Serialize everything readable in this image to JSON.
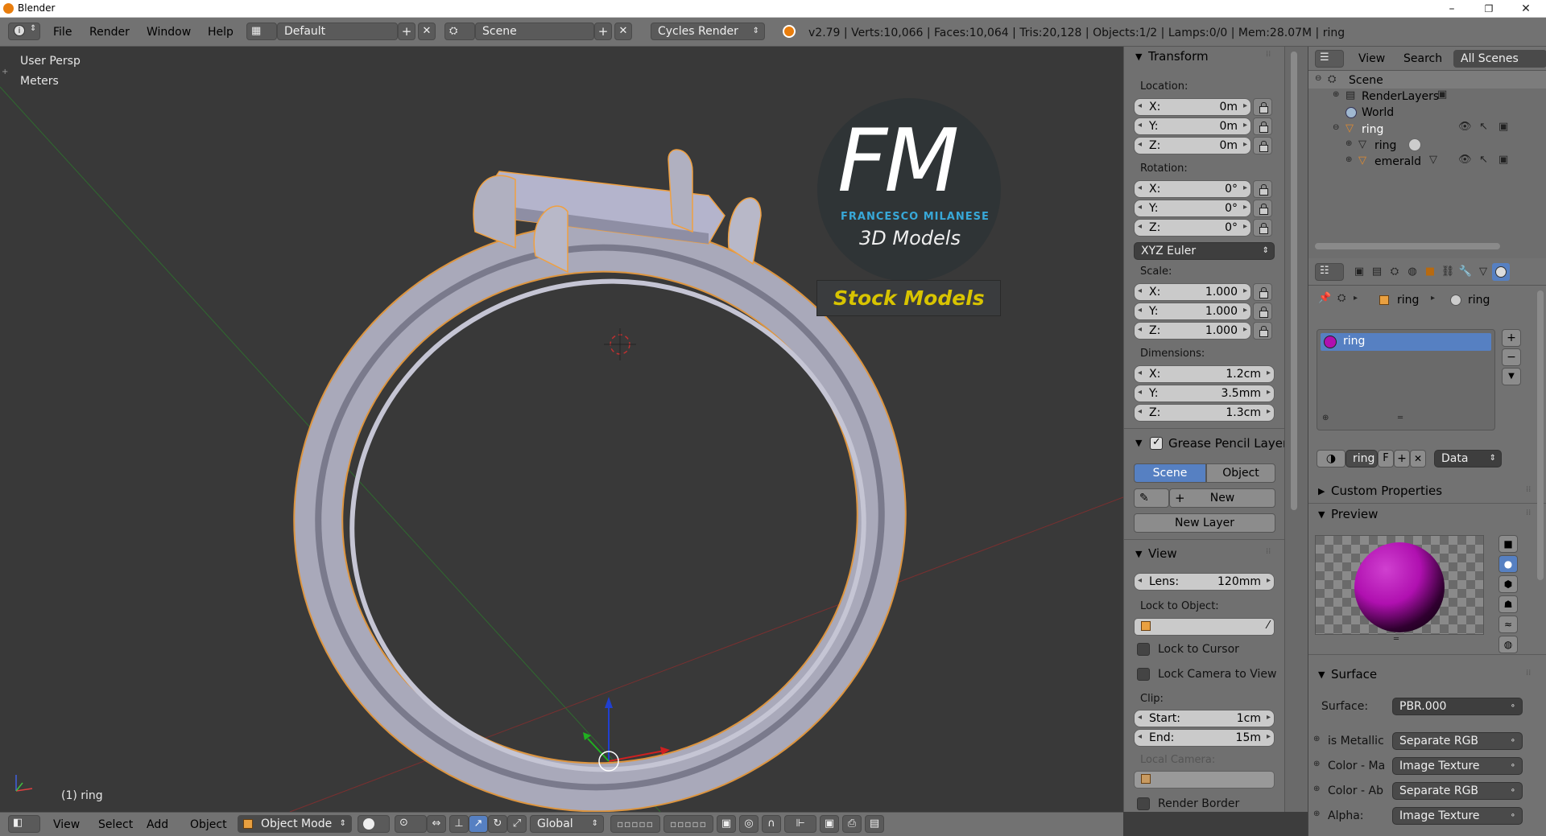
{
  "window": {
    "title": "Blender",
    "minimize": "–",
    "maximize": "❐",
    "close": "✕"
  },
  "topbar": {
    "menus": [
      "File",
      "Render",
      "Window",
      "Help"
    ],
    "screen_layout": "Default",
    "scene": "Scene",
    "render_engine": "Cycles Render",
    "info": "v2.79 | Verts:10,066 | Faces:10,064 | Tris:20,128 | Objects:1/2 | Lamps:0/0 | Mem:28.07M | ring"
  },
  "viewport": {
    "view_name": "User Persp",
    "units": "Meters",
    "object_label": "(1) ring",
    "watermark": {
      "letters": "FM",
      "line1": "FRANCESCO MILANESE",
      "line2": "3D Models",
      "banner": "Stock Models"
    },
    "colors": {
      "background": "#393939",
      "ring": "#b8b8c8",
      "selection": "#f0a040"
    }
  },
  "npanel": {
    "transform_title": "Transform",
    "location_label": "Location:",
    "location": [
      {
        "axis": "X:",
        "value": "0m"
      },
      {
        "axis": "Y:",
        "value": "0m"
      },
      {
        "axis": "Z:",
        "value": "0m"
      }
    ],
    "rotation_label": "Rotation:",
    "rotation": [
      {
        "axis": "X:",
        "value": "0°"
      },
      {
        "axis": "Y:",
        "value": "0°"
      },
      {
        "axis": "Z:",
        "value": "0°"
      }
    ],
    "rotation_mode": "XYZ Euler",
    "scale_label": "Scale:",
    "scale": [
      {
        "axis": "X:",
        "value": "1.000"
      },
      {
        "axis": "Y:",
        "value": "1.000"
      },
      {
        "axis": "Z:",
        "value": "1.000"
      }
    ],
    "dimensions_label": "Dimensions:",
    "dimensions": [
      {
        "axis": "X:",
        "value": "1.2cm"
      },
      {
        "axis": "Y:",
        "value": "3.5mm"
      },
      {
        "axis": "Z:",
        "value": "1.3cm"
      }
    ],
    "grease_title": "Grease Pencil Layer",
    "grease_scene": "Scene",
    "grease_object": "Object",
    "grease_new": "New",
    "grease_new_layer": "New Layer",
    "view_title": "View",
    "lens_label": "Lens:",
    "lens_value": "120mm",
    "lock_to_object": "Lock to Object:",
    "lock_to_cursor": "Lock to Cursor",
    "lock_camera": "Lock Camera to View",
    "clip_label": "Clip:",
    "clip_start_label": "Start:",
    "clip_start": "1cm",
    "clip_end_label": "End:",
    "clip_end": "15m",
    "local_camera": "Local Camera:",
    "render_border": "Render Border"
  },
  "outliner": {
    "menus": [
      "View",
      "Search"
    ],
    "filter": "All Scenes",
    "items": [
      "Scene",
      "RenderLayers",
      "World",
      "ring",
      "ring",
      "emerald"
    ]
  },
  "properties": {
    "breadcrumb": [
      "ring",
      "ring"
    ],
    "slots": [
      "ring"
    ],
    "material_name": "ring",
    "material_users": "F",
    "link": "Data",
    "custom_properties": "Custom Properties",
    "preview": "Preview",
    "surface_section": "Surface",
    "surface_label": "Surface:",
    "surface_value": "PBR.000",
    "inputs": [
      {
        "label": "is Metallic",
        "value": "Separate RGB"
      },
      {
        "label": "Color - Ma",
        "value": "Image Texture"
      },
      {
        "label": "Color - Ab",
        "value": "Separate RGB"
      },
      {
        "label": "Alpha:",
        "value": "Image Texture"
      }
    ],
    "colors": {
      "slot_selected": "#5680c2",
      "sphere": "#b010b0"
    }
  },
  "bottombar": {
    "menus": [
      "View",
      "Select",
      "Add",
      "Object"
    ],
    "mode": "Object Mode",
    "orientation": "Global"
  }
}
